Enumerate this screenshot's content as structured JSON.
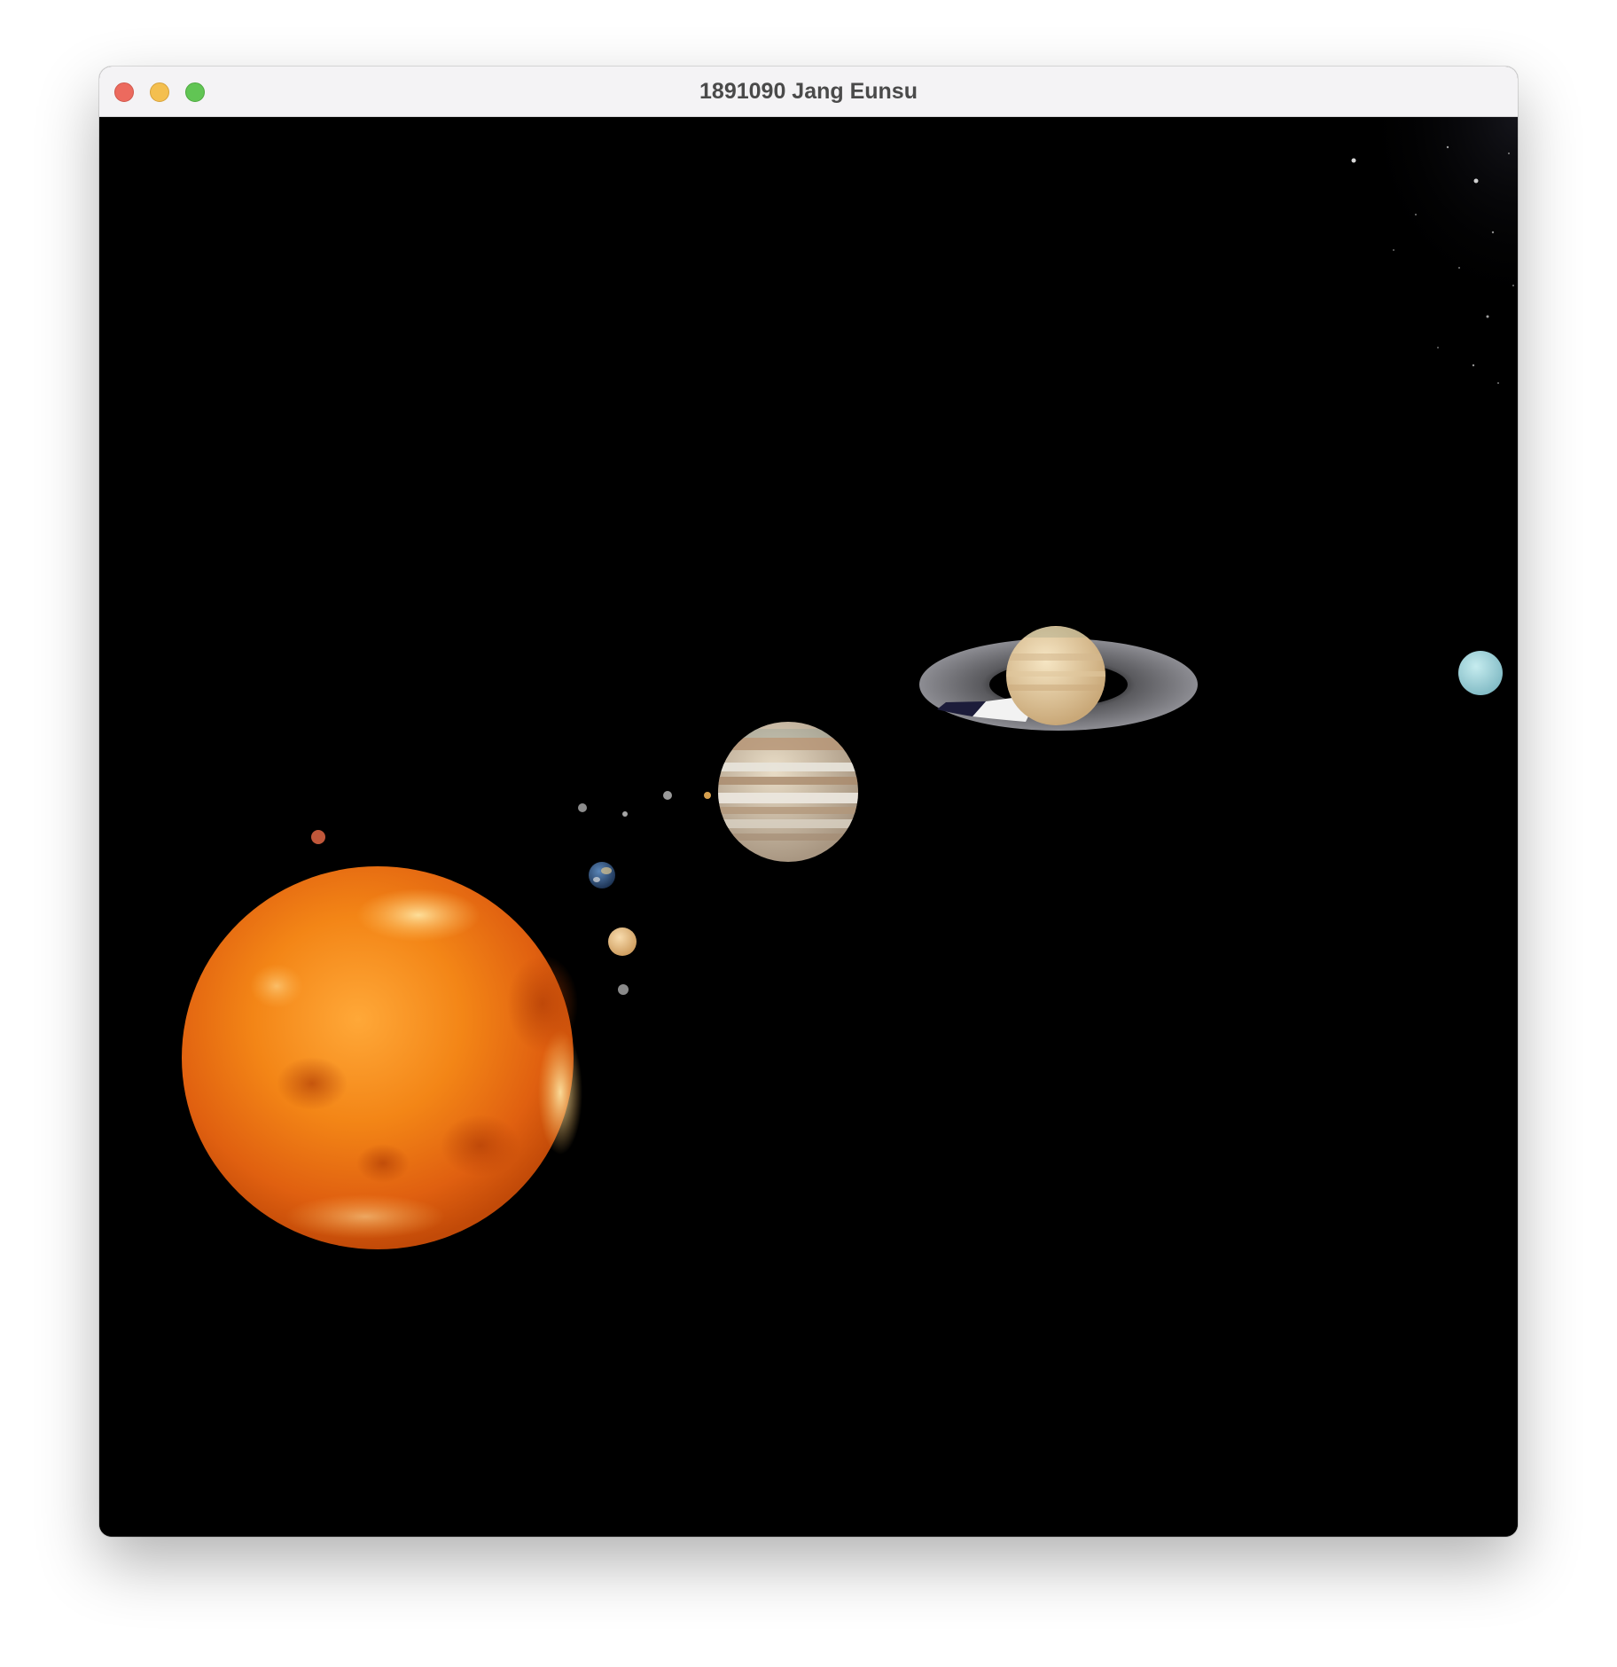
{
  "window": {
    "title": "1891090 Jang Eunsu",
    "controls": [
      "close",
      "minimize",
      "zoom"
    ]
  },
  "scene": {
    "background": "#000000",
    "bodies": [
      {
        "name": "sun",
        "color": "#f07a12"
      },
      {
        "name": "mercury",
        "color": "#8a8a8a"
      },
      {
        "name": "venus",
        "color": "#e6c08a"
      },
      {
        "name": "earth",
        "color": "#2f5a8c"
      },
      {
        "name": "mars",
        "color": "#c0573a"
      },
      {
        "name": "jupiter",
        "color": "#cdb9a0"
      },
      {
        "name": "saturn",
        "color": "#e8d0a6"
      },
      {
        "name": "uranus",
        "color": "#9ad4dc"
      }
    ]
  }
}
